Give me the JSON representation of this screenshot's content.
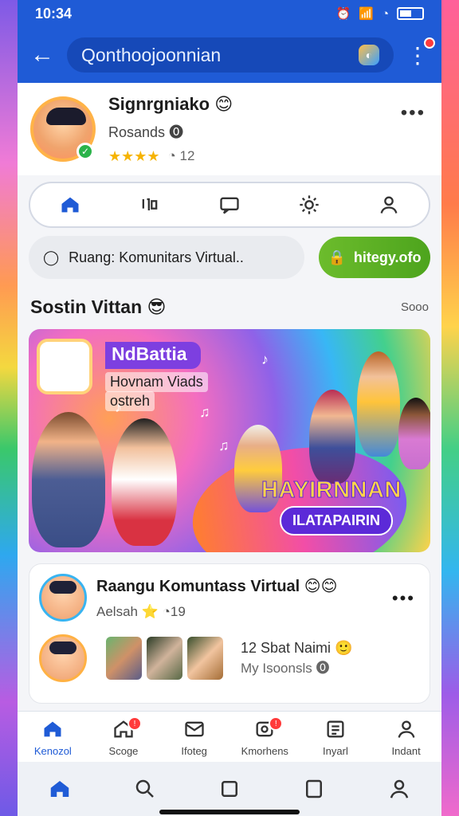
{
  "status": {
    "time": "10:34"
  },
  "header": {
    "search_text": "Qonthoojoonnian"
  },
  "profile": {
    "name": "Signrgniako",
    "subtitle": "Rosands",
    "meta": "12"
  },
  "community": {
    "label": "Ruang: Komunitars Virtual..",
    "cta": "hitegy.ofo"
  },
  "section": {
    "title": "Sostin Vittan",
    "more": "Sooo"
  },
  "banner": {
    "title": "NdBattia",
    "line1": "Hovnam Viads",
    "line2": "ostreh",
    "logo_main": "HAYIRNNAN",
    "logo_sub": "ILATAPAIRIN"
  },
  "card": {
    "title": "Raangu Komuntass Virtual",
    "author": "Aelsah",
    "meta": "19",
    "item_title": "12 Sbat Naimi",
    "item_sub": "My Isoonsls"
  },
  "tabs": [
    "Kenozol",
    "Scoge",
    "Ifoteg",
    "Kmorhens",
    "Inyarl",
    "Indant"
  ]
}
